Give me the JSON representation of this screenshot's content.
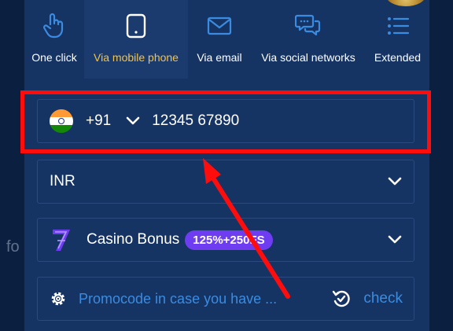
{
  "background_text": "fo",
  "tabs": [
    {
      "label": "One click",
      "icon": "pointer-hand-icon",
      "active": false
    },
    {
      "label": "Via mobile phone",
      "icon": "mobile-phone-icon",
      "active": true
    },
    {
      "label": "Via email",
      "icon": "envelope-icon",
      "active": false
    },
    {
      "label": "Via social networks",
      "icon": "chat-bubbles-icon",
      "active": false
    },
    {
      "label": "Extended",
      "icon": "list-icon",
      "active": false
    }
  ],
  "phone": {
    "country_flag": "india-flag-icon",
    "dial_code": "+91",
    "number": "12345 67890"
  },
  "currency": {
    "value": "INR"
  },
  "bonus": {
    "label": "Casino Bonus",
    "badge": "125%+250FS",
    "icon": "casino-seven-icon"
  },
  "promo": {
    "placeholder": "Promocode in case you have ...",
    "check_label": "check"
  },
  "colors": {
    "page_background": "#0b2041",
    "panel": "#163463",
    "active_tab": "#1b3b6e",
    "active_label": "#f2c24a",
    "icon_blue": "#3b8be0",
    "badge": "#6e3df1",
    "highlight": "#ff0d0d"
  }
}
